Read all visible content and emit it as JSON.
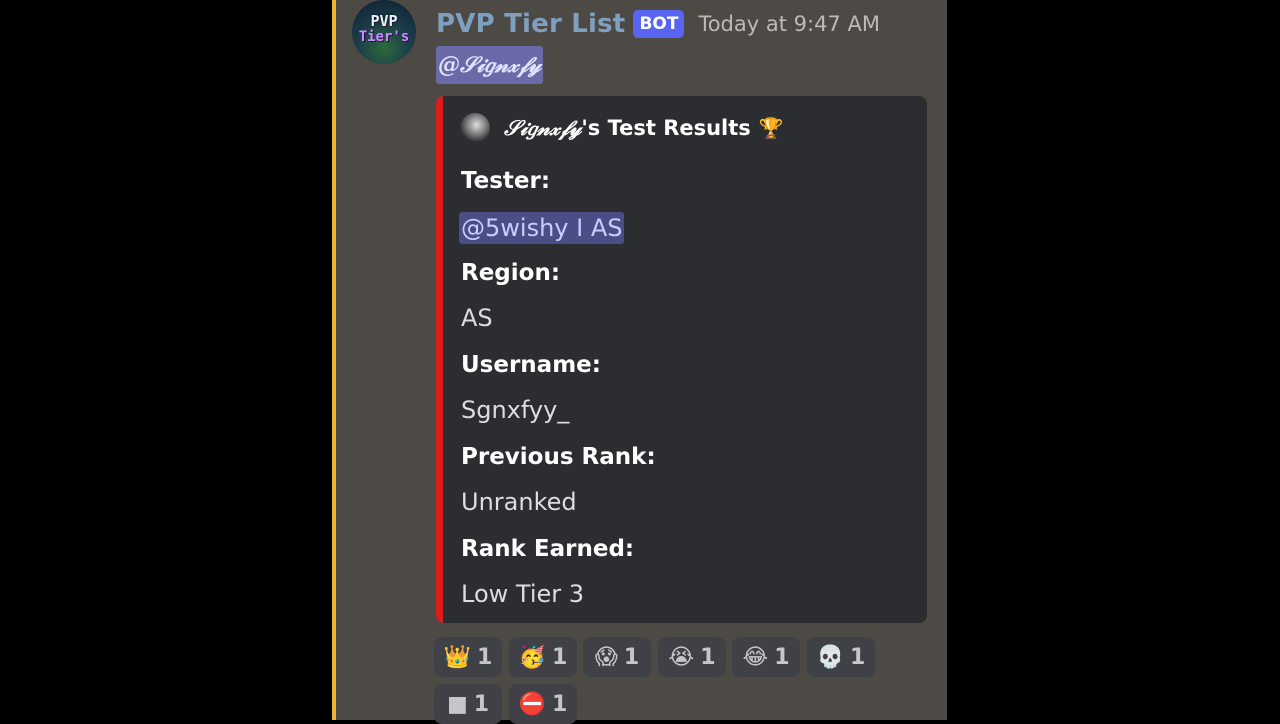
{
  "message": {
    "author": "PVP Tier List",
    "bot_tag": "BOT",
    "timestamp": "Today at 9:47 AM",
    "avatar_text_line1": "PVP",
    "avatar_text_line2": "Tier's",
    "mention": "@𝒮𝒾𝑔𝓃𝓍𝒻𝓎"
  },
  "embed": {
    "title_name": "𝒮𝒾𝑔𝓃𝓍𝒻𝓎",
    "title_suffix": "'s Test Results",
    "title_icon": "🏆",
    "stripe_color": "#e01b1b",
    "fields": [
      {
        "name": "Tester:",
        "value": "@5wishy I AS"
      },
      {
        "name": "Region:",
        "value": "AS"
      },
      {
        "name": "Username:",
        "value": "Sgnxfyy_"
      },
      {
        "name": "Previous Rank:",
        "value": "Unranked"
      },
      {
        "name": "Rank Earned:",
        "value": "Low Tier 3"
      }
    ]
  },
  "reactions": [
    {
      "emoji": "👑",
      "count": "1",
      "icon": "crown-icon"
    },
    {
      "emoji": "🥳",
      "count": "1",
      "icon": "party-face-icon"
    },
    {
      "emoji": "😱",
      "count": "1",
      "icon": "screaming-face-icon"
    },
    {
      "emoji": "😭",
      "count": "1",
      "icon": "crying-face-icon"
    },
    {
      "emoji": "😂",
      "count": "1",
      "icon": "tears-of-joy-icon"
    },
    {
      "emoji": "💀",
      "count": "1",
      "icon": "skull-icon"
    },
    {
      "emoji": "■",
      "count": "1",
      "icon": "square-icon"
    },
    {
      "emoji": "⛔",
      "count": "1",
      "icon": "no-entry-icon"
    }
  ]
}
